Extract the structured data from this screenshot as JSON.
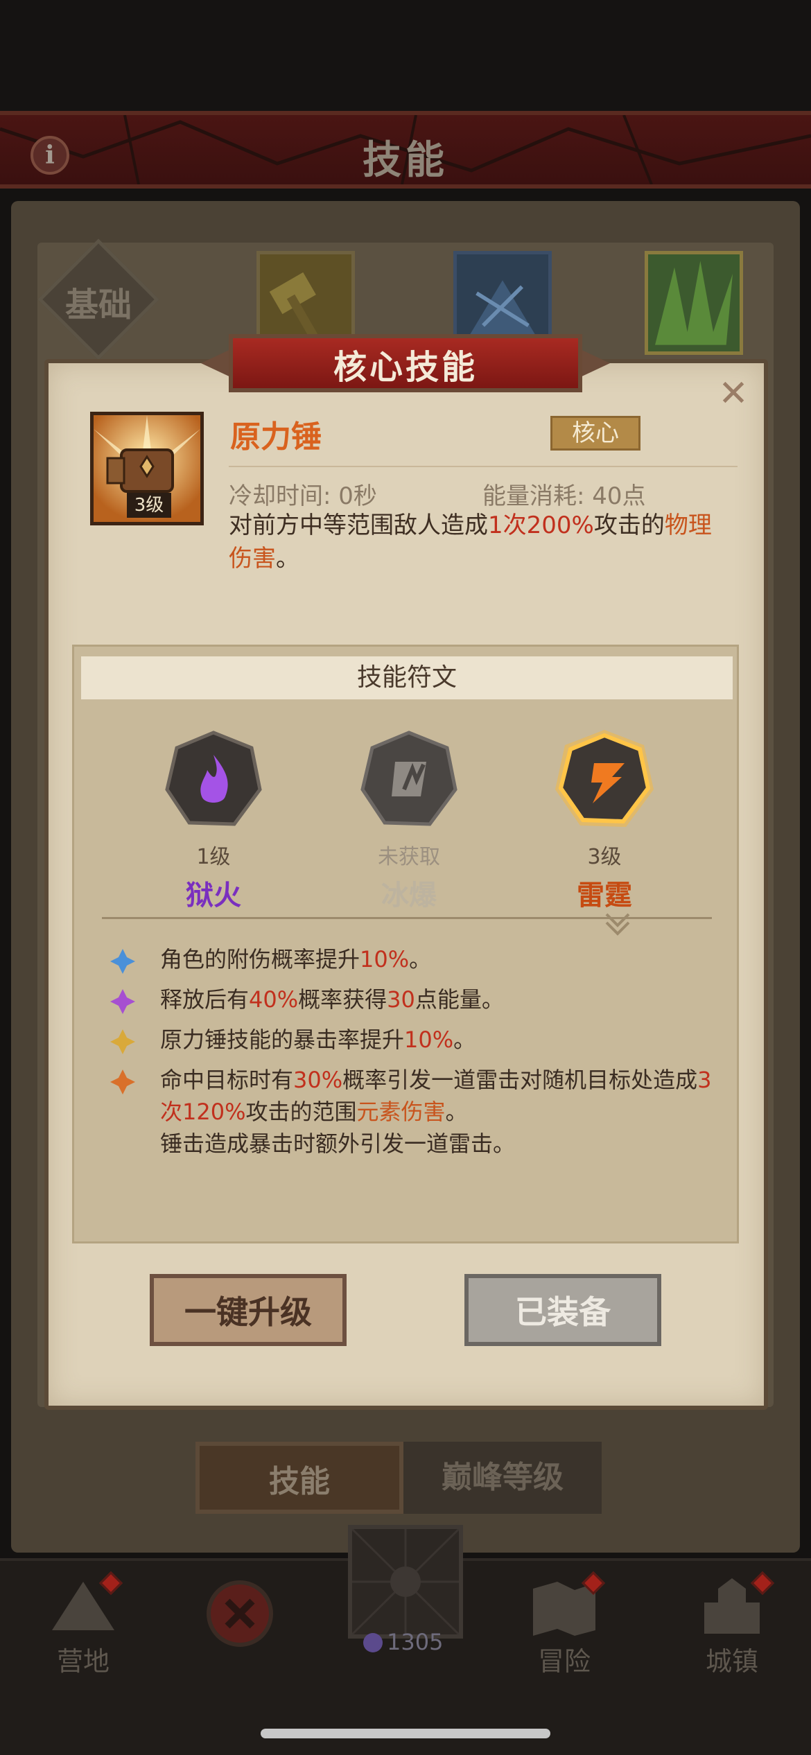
{
  "screen": {
    "title": "技能",
    "info_icon": "info-icon"
  },
  "background": {
    "basic_label": "基础",
    "tabs": [
      "技能",
      "巅峰等级"
    ]
  },
  "modal": {
    "header": "核心技能",
    "close_icon": "close-icon",
    "skill": {
      "name": "原力锤",
      "level": "3级",
      "badge": "核心",
      "cooldown": "冷却时间: 0秒",
      "energy": "能量消耗: 40点",
      "description": {
        "p1": "对前方中等范围敌人造成",
        "v1": "1次",
        "v2": "200%",
        "p2": "攻击的",
        "v3": "物理伤害",
        "p3": "。"
      }
    },
    "rune_section": {
      "title": "技能符文",
      "runes": [
        {
          "level": "1级",
          "name": "狱火",
          "color": "#7a2fbf",
          "icon": "flame-icon"
        },
        {
          "level": "未获取",
          "name": "冰爆",
          "color": "#bdb39f",
          "icon": "ice-icon"
        },
        {
          "level": "3级",
          "name": "雷霆",
          "color": "#c64b12",
          "icon": "lightning-icon"
        }
      ],
      "effects": [
        {
          "icon": "blue-diamond-icon",
          "color": "#4a90d9",
          "parts": [
            "角色的附伤概率提升",
            "10%",
            "。"
          ]
        },
        {
          "icon": "purple-diamond-icon",
          "color": "#a64fd1",
          "parts": [
            "释放后有",
            "40%",
            "概率获得",
            "30",
            "点能量。"
          ]
        },
        {
          "icon": "yellow-diamond-icon",
          "color": "#d9a93a",
          "parts": [
            "原力锤技能的暴击率提升",
            "10%",
            "。"
          ]
        },
        {
          "icon": "orange-diamond-icon",
          "color": "#d9702a",
          "parts": [
            "命中目标时有",
            "30%",
            "概率引发一道雷击对随机目标处造成",
            "3次",
            "120%",
            "攻击的范围",
            "元素伤害",
            "。",
            "锤击造成暴击时额外引发一道雷击。"
          ]
        }
      ]
    },
    "buttons": {
      "upgrade": "一键升级",
      "equipped": "已装备"
    }
  },
  "nav": {
    "camp": "营地",
    "adventure": "冒险",
    "town": "城镇",
    "currency": "1305"
  }
}
